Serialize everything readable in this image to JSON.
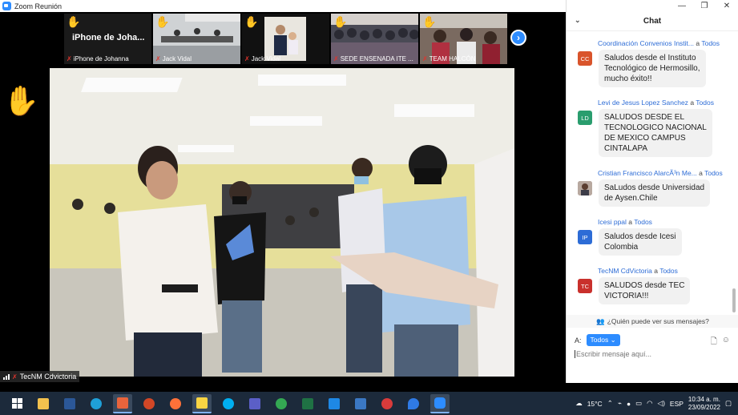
{
  "window": {
    "title": "Zoom Reunión"
  },
  "thumbnails": [
    {
      "label": "iPhone de Johanna",
      "big_label": "iPhone de Joha...",
      "hand": "✋",
      "style": "dark"
    },
    {
      "label": "Jack Vidal",
      "hand": "✋",
      "style": "room"
    },
    {
      "label": "Jack Vidal",
      "hand": "✋",
      "style": "portrait"
    },
    {
      "label": "SEDE ENSENADA ITE ...",
      "hand": "✋",
      "style": "crowd"
    },
    {
      "label": "TEAM HALCÓN",
      "hand": "✋",
      "style": "group"
    }
  ],
  "main_video": {
    "speaker": "TecNM Cdvictoria",
    "hand": "✋"
  },
  "chat": {
    "title": "Chat",
    "messages": [
      {
        "sender": "Coordinación Convenios Instit...",
        "to": "Todos",
        "initials": "CC",
        "color": "#d9542b",
        "text": [
          "Saludos desde el Instituto",
          "Tecnológico de Hermosillo,",
          "mucho éxito!!"
        ]
      },
      {
        "sender": "Levi de Jesus Lopez Sanchez",
        "to": "Todos",
        "initials": "LD",
        "color": "#2a9d6e",
        "text": [
          "SALUDOS DESDE EL",
          "TECNOLOGICO NACIONAL",
          "DE MEXICO CAMPUS",
          "CINTALAPA"
        ]
      },
      {
        "sender": "Cristian Francisco AlarcÃ³n Me...",
        "to": "Todos",
        "initials": "",
        "color": "#8a6a5a",
        "text": [
          "SaLudos desde Universidad",
          "de Aysen.Chile"
        ]
      },
      {
        "sender": "Icesi ppal",
        "to": "Todos",
        "initials": "IP",
        "color": "#2d6cd6",
        "text": [
          "Saludos desde Icesi",
          "Colombia"
        ]
      },
      {
        "sender": "TecNM CdVictoria",
        "to": "Todos",
        "initials": "TC",
        "color": "#c9302c",
        "text": [
          "SALUDOS desde TEC",
          "VICTORIA!!!"
        ]
      }
    ],
    "to_word": "a",
    "visibility_text": "¿Quién puede ver sus mensajes?",
    "to_label": "A:",
    "to_value": "Todos",
    "input_placeholder": "Escribir mensaje aquí..."
  },
  "taskbar": {
    "weather": "15°C",
    "language": "ESP",
    "time": "10:34 a. m.",
    "date": "23/09/2022",
    "apps": [
      {
        "name": "windows-start",
        "color": "#ffffff"
      },
      {
        "name": "file-explorer",
        "color": "#f2c14e"
      },
      {
        "name": "word",
        "color": "#2b5797"
      },
      {
        "name": "edge",
        "color": "#1fa0d8"
      },
      {
        "name": "skype-badge",
        "color": "#e8643c"
      },
      {
        "name": "powerpoint",
        "color": "#d24726"
      },
      {
        "name": "firefox",
        "color": "#ff7139"
      },
      {
        "name": "sticky-notes",
        "color": "#f9d443"
      },
      {
        "name": "skype",
        "color": "#00aff0"
      },
      {
        "name": "teams",
        "color": "#5b5fc7"
      },
      {
        "name": "chrome",
        "color": "#34a853"
      },
      {
        "name": "excel",
        "color": "#1f7244"
      },
      {
        "name": "media-player",
        "color": "#1e88e5"
      },
      {
        "name": "photos",
        "color": "#3b78c3"
      },
      {
        "name": "paint",
        "color": "#d83b3b"
      },
      {
        "name": "droplet-app",
        "color": "#2f7ae5"
      },
      {
        "name": "zoom",
        "color": "#2d8cff"
      }
    ]
  }
}
